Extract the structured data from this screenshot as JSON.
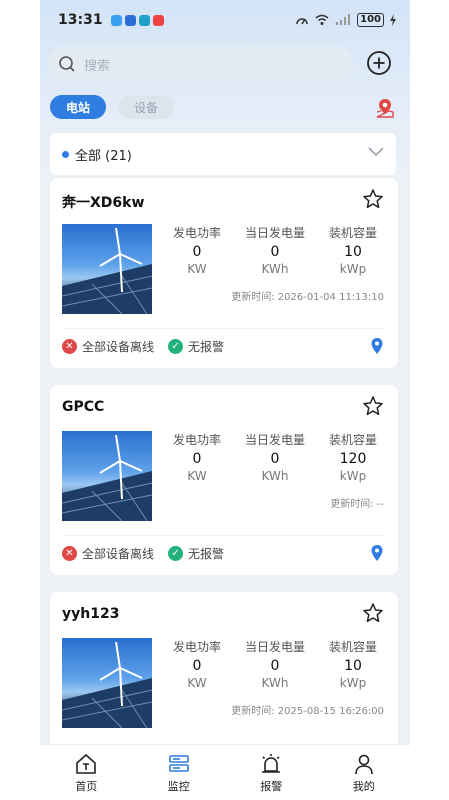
{
  "status": {
    "time": "13:31",
    "battery": "100"
  },
  "search": {
    "placeholder": "搜索"
  },
  "tabs": [
    {
      "label": "电站",
      "active": true
    },
    {
      "label": "设备",
      "active": false
    }
  ],
  "filter": {
    "label": "全部 (21)"
  },
  "metric_labels": {
    "power": "发电功率",
    "today": "当日发电量",
    "capacity": "装机容量"
  },
  "stations": [
    {
      "name": "奔一XD6kw",
      "power": "0",
      "power_unit": "KW",
      "today": "0",
      "today_unit": "KWh",
      "capacity": "10",
      "capacity_unit": "kWp",
      "updated": "更新时间: 2026-01-04 11:13:10",
      "device_status": "全部设备离线",
      "alarm_status": "无报警"
    },
    {
      "name": "GPCC",
      "power": "0",
      "power_unit": "KW",
      "today": "0",
      "today_unit": "KWh",
      "capacity": "120",
      "capacity_unit": "kWp",
      "updated": "更新时间: --",
      "device_status": "全部设备离线",
      "alarm_status": "无报警"
    },
    {
      "name": "yyh123",
      "power": "0",
      "power_unit": "KW",
      "today": "0",
      "today_unit": "KWh",
      "capacity": "10",
      "capacity_unit": "kWp",
      "updated": "更新时间: 2025-08-15 16:26:00",
      "device_status": "",
      "alarm_status": ""
    }
  ],
  "nav": [
    {
      "label": "首页",
      "icon": "home-icon"
    },
    {
      "label": "监控",
      "icon": "monitor-icon"
    },
    {
      "label": "报警",
      "icon": "alarm-icon"
    },
    {
      "label": "我的",
      "icon": "user-icon"
    }
  ],
  "colors": {
    "accent": "#2f7de1",
    "offline": "#e04848",
    "ok": "#22b07d"
  }
}
